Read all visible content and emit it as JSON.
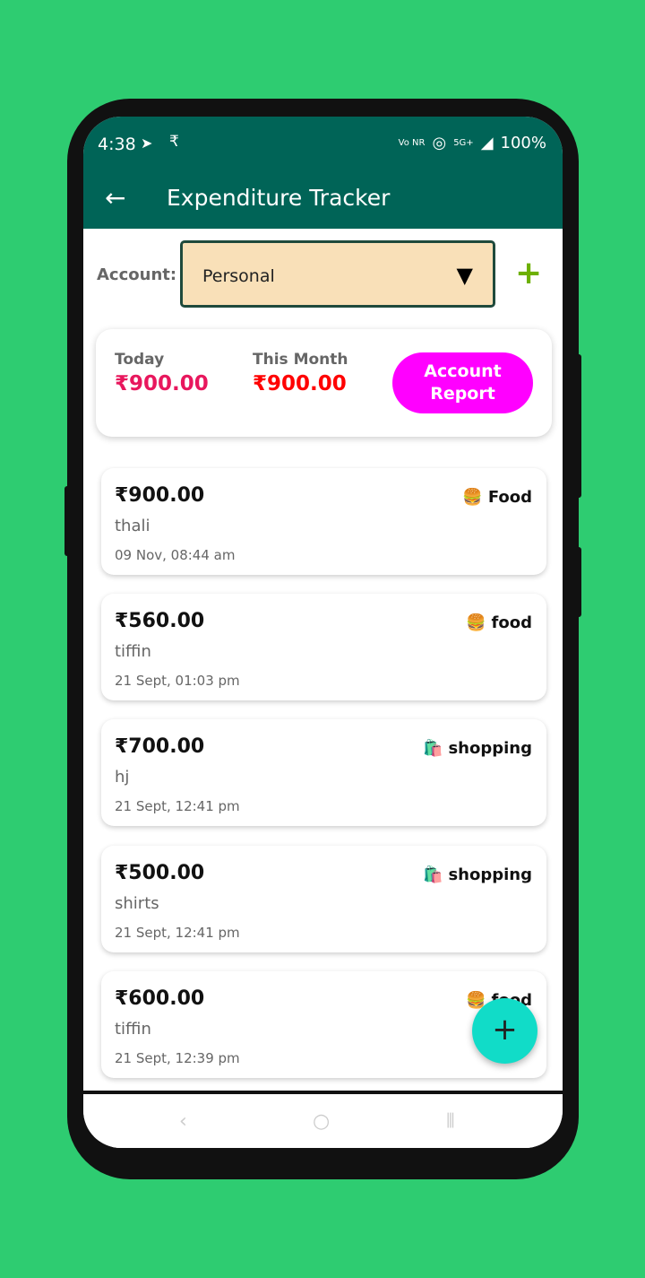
{
  "status": {
    "time": "4:38",
    "telegram_icon": "➤",
    "rupee_icon": "₹",
    "volte": "Vo NR",
    "hotspot_icon": "◎",
    "network": "5G+",
    "battery": "100%"
  },
  "appbar": {
    "back_icon": "←",
    "title": "Expenditure Tracker"
  },
  "account": {
    "label": "Account:",
    "selected": "Personal",
    "dropdown_icon": "▼",
    "add_icon": "+"
  },
  "summary": {
    "today_label": "Today",
    "today_amount": "₹900.00",
    "month_label": "This Month",
    "month_amount": "₹900.00",
    "report_button": "Account Report",
    "today_color": "#e8175d",
    "month_color": "#ff0000"
  },
  "expenses": [
    {
      "amount": "₹900.00",
      "desc": "thali",
      "date": "09 Nov, 08:44 am",
      "category": "Food",
      "icon": "🍔"
    },
    {
      "amount": "₹560.00",
      "desc": "tiffin",
      "date": "21 Sept, 01:03 pm",
      "category": "food",
      "icon": "🍔"
    },
    {
      "amount": "₹700.00",
      "desc": "hj",
      "date": "21 Sept, 12:41 pm",
      "category": "shopping",
      "icon": "🛍️"
    },
    {
      "amount": "₹500.00",
      "desc": "shirts",
      "date": "21 Sept, 12:41 pm",
      "category": "shopping",
      "icon": "🛍️"
    },
    {
      "amount": "₹600.00",
      "desc": "tiffin",
      "date": "21 Sept, 12:39 pm",
      "category": "food",
      "icon": "🍔"
    }
  ],
  "fab": {
    "icon": "+"
  },
  "navbar": {
    "back_icon": "‹",
    "home_icon": "○",
    "recents_icon": "⦀"
  }
}
